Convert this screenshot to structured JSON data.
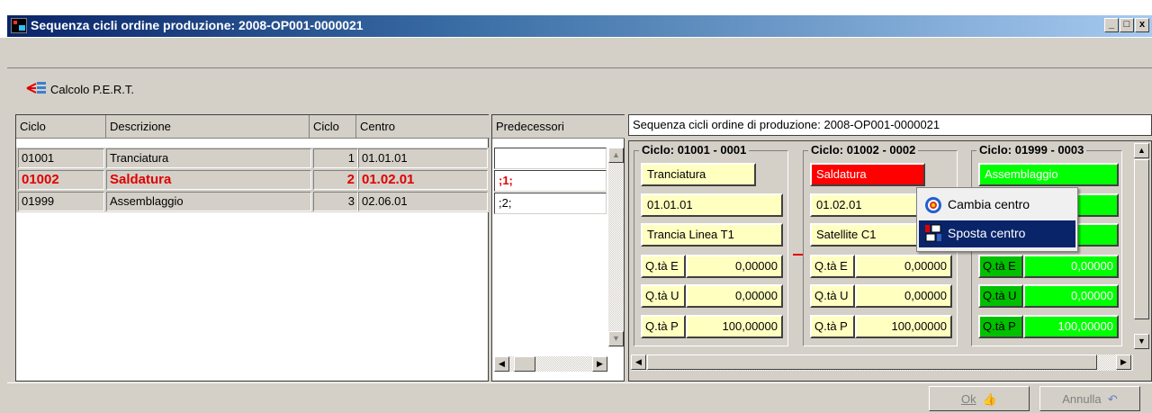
{
  "window": {
    "title": "Sequenza cicli ordine produzione: 2008-OP001-0000021",
    "min": "_",
    "max": "□",
    "close": "x"
  },
  "toolbar": {
    "pert_label": "Calcolo P.E.R.T."
  },
  "grid": {
    "headers": [
      "Ciclo",
      "Descrizione",
      "Ciclo",
      "Centro"
    ],
    "rows": [
      {
        "ciclo": "01001",
        "descrizione": "Tranciatura",
        "seq": "1",
        "centro": "01.01.01",
        "selected": false
      },
      {
        "ciclo": "01002",
        "descrizione": "Saldatura",
        "seq": "2",
        "centro": "01.02.01",
        "selected": true
      },
      {
        "ciclo": "01999",
        "descrizione": "Assemblaggio",
        "seq": "3",
        "centro": "02.06.01",
        "selected": false
      }
    ]
  },
  "predecessors": {
    "header": "Predecessori",
    "values": [
      "",
      ";1;",
      ";2;"
    ]
  },
  "sequence": {
    "header": "Sequenza cicli ordine di produzione: 2008-OP001-0000021",
    "cycles": [
      {
        "title": "Ciclo: 01001 - 0001",
        "desc": "Tranciatura",
        "centro": "01.01.01",
        "macchina": "Trancia Linea T1",
        "qe_label": "Q.tà E",
        "qe": "0,00000",
        "qu_label": "Q.tà U",
        "qu": "0,00000",
        "qp_label": "Q.tà P",
        "qp": "100,00000"
      },
      {
        "title": "Ciclo: 01002 - 0002",
        "desc": "Saldatura",
        "centro": "01.02.01",
        "macchina": "Satellite C1",
        "qe_label": "Q.tà E",
        "qe": "0,00000",
        "qu_label": "Q.tà U",
        "qu": "0,00000",
        "qp_label": "Q.tà P",
        "qp": "100,00000"
      },
      {
        "title": "Ciclo: 01999 - 0003",
        "desc": "Assemblaggio",
        "centro": "",
        "macchina": "",
        "qe_label": "Q.tà E",
        "qe": "0,00000",
        "qu_label": "Q.tà U",
        "qu": "0,00000",
        "qp_label": "Q.tà P",
        "qp": "100,00000"
      }
    ]
  },
  "context_menu": {
    "items": [
      {
        "label": "Cambia centro",
        "icon": "target-icon"
      },
      {
        "label": "Sposta centro",
        "icon": "move-icon"
      }
    ]
  },
  "buttons": {
    "ok": "Ok",
    "cancel": "Annulla"
  },
  "colors": {
    "title_bar": "#0a246a",
    "selected_text": "#e00000",
    "cycle_red": "#ff0000",
    "cycle_green": "#00ff00",
    "note_yellow": "#ffffc0"
  }
}
